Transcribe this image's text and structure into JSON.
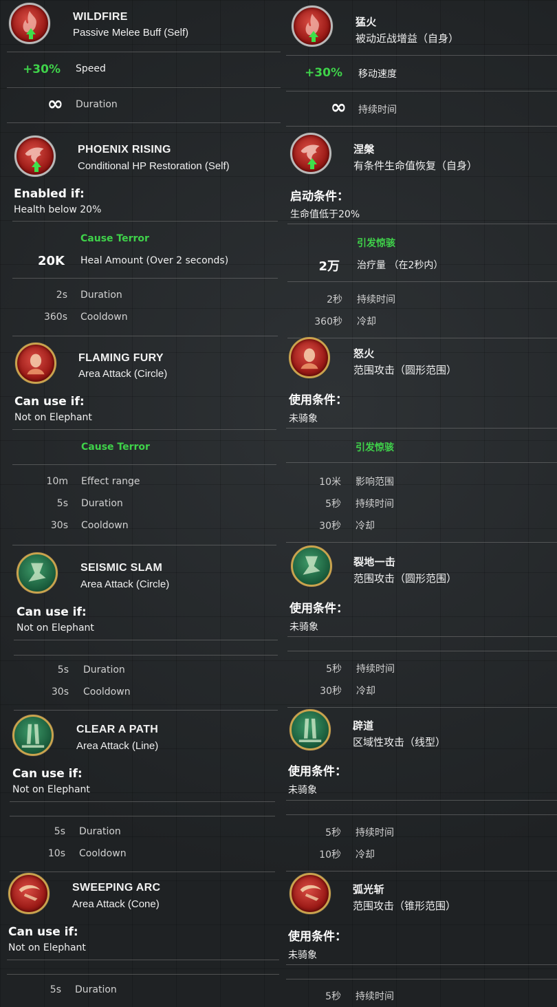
{
  "left": {
    "wildfire": {
      "title": "WILDFIRE",
      "subtitle": "Passive Melee Buff (Self)",
      "speed_value": "+30%",
      "speed_label": "Speed",
      "duration_value": "∞",
      "duration_label": "Duration"
    },
    "phoenix": {
      "title": "PHOENIX RISING",
      "subtitle": "Conditional HP Restoration (Self)",
      "cond_label": "Enabled if:",
      "cond_value": "Health below 20%",
      "tag": "Cause Terror",
      "heal_value": "20K",
      "heal_label": "Heal Amount  (Over 2 seconds)",
      "duration_value": "2s",
      "duration_label": "Duration",
      "cooldown_value": "360s",
      "cooldown_label": "Cooldown"
    },
    "flaming": {
      "title": "FLAMING FURY",
      "subtitle": "Area Attack (Circle)",
      "cond_label": "Can use if:",
      "cond_value": "Not on Elephant",
      "tag": "Cause Terror",
      "range_value": "10m",
      "range_label": "Effect range",
      "duration_value": "5s",
      "duration_label": "Duration",
      "cooldown_value": "30s",
      "cooldown_label": "Cooldown"
    },
    "seismic": {
      "title": "SEISMIC SLAM",
      "subtitle": "Area Attack (Circle)",
      "cond_label": "Can use if:",
      "cond_value": "Not on Elephant",
      "duration_value": "5s",
      "duration_label": "Duration",
      "cooldown_value": "30s",
      "cooldown_label": "Cooldown"
    },
    "clear": {
      "title": "CLEAR A PATH",
      "subtitle": "Area Attack (Line)",
      "cond_label": "Can use if:",
      "cond_value": "Not on Elephant",
      "duration_value": "5s",
      "duration_label": "Duration",
      "cooldown_value": "10s",
      "cooldown_label": "Cooldown"
    },
    "sweeping": {
      "title": "SWEEPING ARC",
      "subtitle": "Area Attack (Cone)",
      "cond_label": "Can use if:",
      "cond_value": "Not on Elephant",
      "duration_value": "5s",
      "duration_label": "Duration"
    }
  },
  "right": {
    "wildfire": {
      "title": "猛火",
      "subtitle": "被动近战增益（自身）",
      "speed_value": "+30%",
      "speed_label": "移动速度",
      "duration_value": "∞",
      "duration_label": "持续时间"
    },
    "phoenix": {
      "title": "涅槃",
      "subtitle": "有条件生命值恢复（自身）",
      "cond_label": "启动条件：",
      "cond_value": "生命值低于20%",
      "tag": "引发惊骇",
      "heal_value": "2万",
      "heal_label": "治疗量 （在2秒内）",
      "duration_value": "2秒",
      "duration_label": "持续时间",
      "cooldown_value": "360秒",
      "cooldown_label": "冷却"
    },
    "flaming": {
      "title": "怒火",
      "subtitle": "范围攻击（圆形范围）",
      "cond_label": "使用条件：",
      "cond_value": "未骑象",
      "tag": "引发惊骇",
      "range_value": "10米",
      "range_label": "影响范围",
      "duration_value": "5秒",
      "duration_label": "持续时间",
      "cooldown_value": "30秒",
      "cooldown_label": "冷却"
    },
    "seismic": {
      "title": "裂地一击",
      "subtitle": "范围攻击（圆形范围）",
      "cond_label": "使用条件：",
      "cond_value": "未骑象",
      "duration_value": "5秒",
      "duration_label": "持续时间",
      "cooldown_value": "30秒",
      "cooldown_label": "冷却"
    },
    "clear": {
      "title": "辟道",
      "subtitle": "区域性攻击（线型）",
      "cond_label": "使用条件：",
      "cond_value": "未骑象",
      "duration_value": "5秒",
      "duration_label": "持续时间",
      "cooldown_value": "10秒",
      "cooldown_label": "冷却"
    },
    "sweeping": {
      "title": "弧光斩",
      "subtitle": "范围攻击（锥形范围）",
      "cond_label": "使用条件：",
      "cond_value": "未骑象",
      "duration_value": "5秒",
      "duration_label": "持续时间"
    }
  },
  "colors": {
    "accent_green": "#3fd24a",
    "fire_red": "#9c1b17",
    "nature_green": "#1b5e3d",
    "gold_rim": "#c9a34e"
  },
  "icons": [
    "fire-buff-icon",
    "phoenix-icon",
    "flaming-fury-icon",
    "seismic-slam-icon",
    "clear-a-path-icon",
    "sweeping-arc-icon"
  ]
}
